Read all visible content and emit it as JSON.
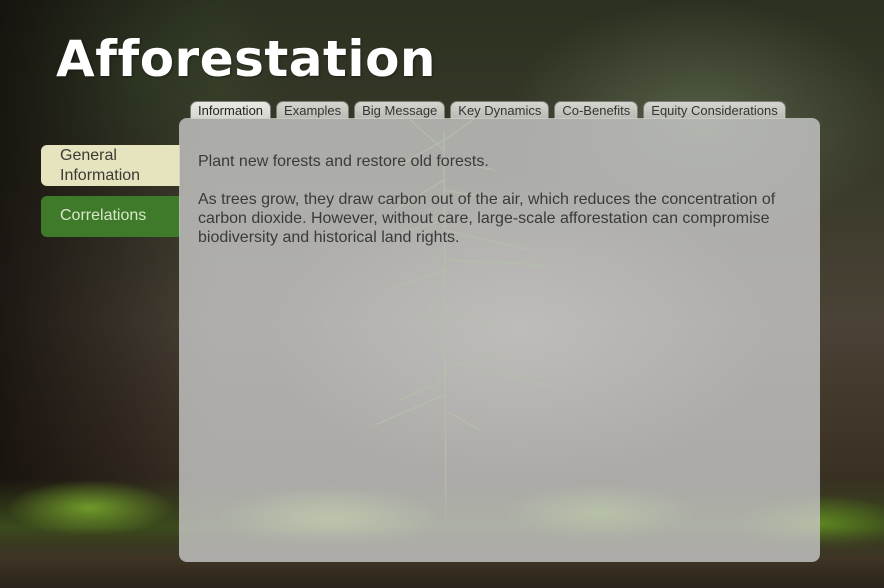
{
  "title": "Afforestation",
  "tabs": [
    {
      "label": "Information",
      "active": true
    },
    {
      "label": "Examples",
      "active": false
    },
    {
      "label": "Big Message",
      "active": false
    },
    {
      "label": "Key Dynamics",
      "active": false
    },
    {
      "label": "Co-Benefits",
      "active": false
    },
    {
      "label": "Equity Considerations",
      "active": false
    }
  ],
  "side_tabs": [
    {
      "label": "General Information",
      "active": true
    },
    {
      "label": "Correlations",
      "active": false
    }
  ],
  "content": {
    "paragraphs": [
      "Plant new forests and restore old forests.",
      "As trees grow, they draw carbon out of the air, which reduces the concentration of carbon dioxide. However, without care, large-scale afforestation can compromise biodiversity and historical land rights."
    ]
  },
  "colors": {
    "side_tab_active": "#e6e3bf",
    "side_tab_inactive": "#3f7a2a",
    "panel": "#cdcdcd"
  }
}
